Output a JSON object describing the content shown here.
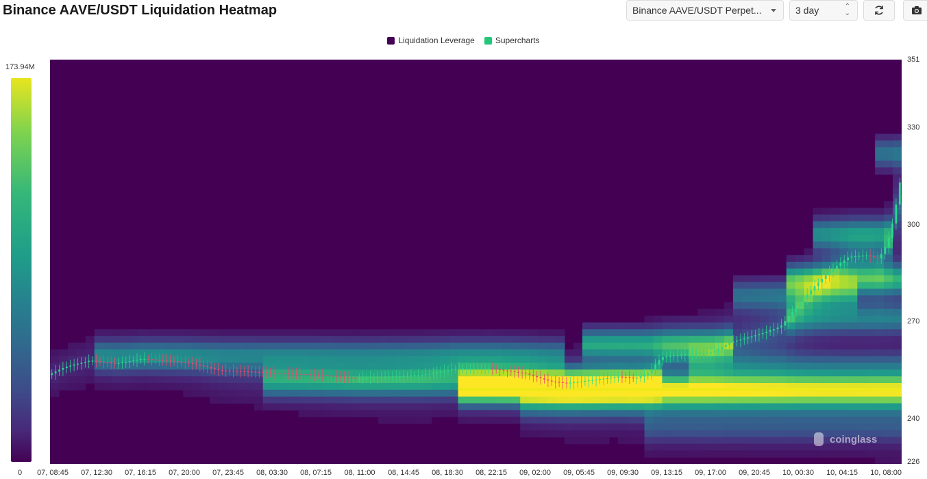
{
  "header": {
    "title": "Binance AAVE/USDT Liquidation Heatmap",
    "pair_select": "Binance AAVE/USDT Perpet...",
    "range_select": "3 day",
    "refresh_icon": "refresh-icon",
    "camera_icon": "camera-icon"
  },
  "legend": [
    {
      "label": "Liquidation Leverage",
      "color": "#440154"
    },
    {
      "label": "Supercharts",
      "color": "#22c77a"
    }
  ],
  "colorbar": {
    "max_label": "173.94M",
    "min_label": "0"
  },
  "watermark": "coinglass",
  "chart_data": {
    "type": "heatmap",
    "title": "Binance AAVE/USDT Liquidation Heatmap",
    "xlabel": "",
    "ylabel": "",
    "x_ticks": [
      "07, 08:45",
      "07, 12:30",
      "07, 16:15",
      "07, 20:00",
      "07, 23:45",
      "08, 03:30",
      "08, 07:15",
      "08, 11:00",
      "08, 14:45",
      "08, 18:30",
      "08, 22:15",
      "09, 02:00",
      "09, 05:45",
      "09, 09:30",
      "09, 13:15",
      "09, 17:00",
      "09, 20:45",
      "10, 00:30",
      "10, 04:15",
      "10, 08:00"
    ],
    "y_ticks": [
      351,
      330,
      300,
      270,
      240,
      226
    ],
    "ylim": [
      226,
      351
    ],
    "colorscale": [
      "#440154",
      "#482878",
      "#3e4a89",
      "#31688e",
      "#26828e",
      "#1f9e89",
      "#35b779",
      "#6ece58",
      "#b5de2b",
      "#fde725"
    ],
    "value_range": [
      0,
      173940000
    ],
    "price_path": [
      {
        "t": 0.0,
        "p": 253.5
      },
      {
        "t": 0.02,
        "p": 256.0
      },
      {
        "t": 0.05,
        "p": 258.0
      },
      {
        "t": 0.08,
        "p": 257.0
      },
      {
        "t": 0.11,
        "p": 258.5
      },
      {
        "t": 0.14,
        "p": 258.0
      },
      {
        "t": 0.17,
        "p": 257.0
      },
      {
        "t": 0.2,
        "p": 255.0
      },
      {
        "t": 0.24,
        "p": 254.5
      },
      {
        "t": 0.28,
        "p": 254.0
      },
      {
        "t": 0.32,
        "p": 253.5
      },
      {
        "t": 0.36,
        "p": 252.5
      },
      {
        "t": 0.4,
        "p": 253.0
      },
      {
        "t": 0.44,
        "p": 253.5
      },
      {
        "t": 0.48,
        "p": 255.5
      },
      {
        "t": 0.52,
        "p": 255.5
      },
      {
        "t": 0.56,
        "p": 254.0
      },
      {
        "t": 0.59,
        "p": 251.5
      },
      {
        "t": 0.61,
        "p": 251.0
      },
      {
        "t": 0.64,
        "p": 252.0
      },
      {
        "t": 0.67,
        "p": 253.0
      },
      {
        "t": 0.69,
        "p": 252.5
      },
      {
        "t": 0.705,
        "p": 254.0
      },
      {
        "t": 0.72,
        "p": 259.0
      },
      {
        "t": 0.75,
        "p": 260.0
      },
      {
        "t": 0.78,
        "p": 260.5
      },
      {
        "t": 0.8,
        "p": 263.5
      },
      {
        "t": 0.82,
        "p": 265.0
      },
      {
        "t": 0.84,
        "p": 266.5
      },
      {
        "t": 0.86,
        "p": 268.5
      },
      {
        "t": 0.88,
        "p": 275.0
      },
      {
        "t": 0.9,
        "p": 281.0
      },
      {
        "t": 0.92,
        "p": 286.0
      },
      {
        "t": 0.94,
        "p": 290.0
      },
      {
        "t": 0.96,
        "p": 290.5
      },
      {
        "t": 0.975,
        "p": 289.5
      },
      {
        "t": 0.985,
        "p": 294.0
      },
      {
        "t": 0.993,
        "p": 302.0
      },
      {
        "t": 1.0,
        "p": 313.0
      }
    ],
    "liquidation_bands": [
      {
        "price": 249.0,
        "intensity": 1.0,
        "from": 0.48,
        "to": 1.0
      },
      {
        "price": 251.5,
        "intensity": 0.55,
        "from": 0.25,
        "to": 0.72
      },
      {
        "price": 263.0,
        "intensity": 0.65,
        "from": 0.62,
        "to": 0.8
      },
      {
        "price": 259.5,
        "intensity": 0.45,
        "from": 0.05,
        "to": 0.6
      },
      {
        "price": 283.0,
        "intensity": 0.7,
        "from": 0.86,
        "to": 1.0
      },
      {
        "price": 271.0,
        "intensity": 0.45,
        "from": 0.86,
        "to": 1.0
      },
      {
        "price": 256.0,
        "intensity": 0.35,
        "from": 0.75,
        "to": 1.0
      },
      {
        "price": 244.0,
        "intensity": 0.3,
        "from": 0.55,
        "to": 1.0
      },
      {
        "price": 237.0,
        "intensity": 0.25,
        "from": 0.7,
        "to": 1.0
      },
      {
        "price": 297.0,
        "intensity": 0.55,
        "from": 0.9,
        "to": 0.99
      },
      {
        "price": 322.0,
        "intensity": 0.45,
        "from": 0.97,
        "to": 1.0
      },
      {
        "price": 278.0,
        "intensity": 0.4,
        "from": 0.8,
        "to": 0.95
      }
    ]
  }
}
